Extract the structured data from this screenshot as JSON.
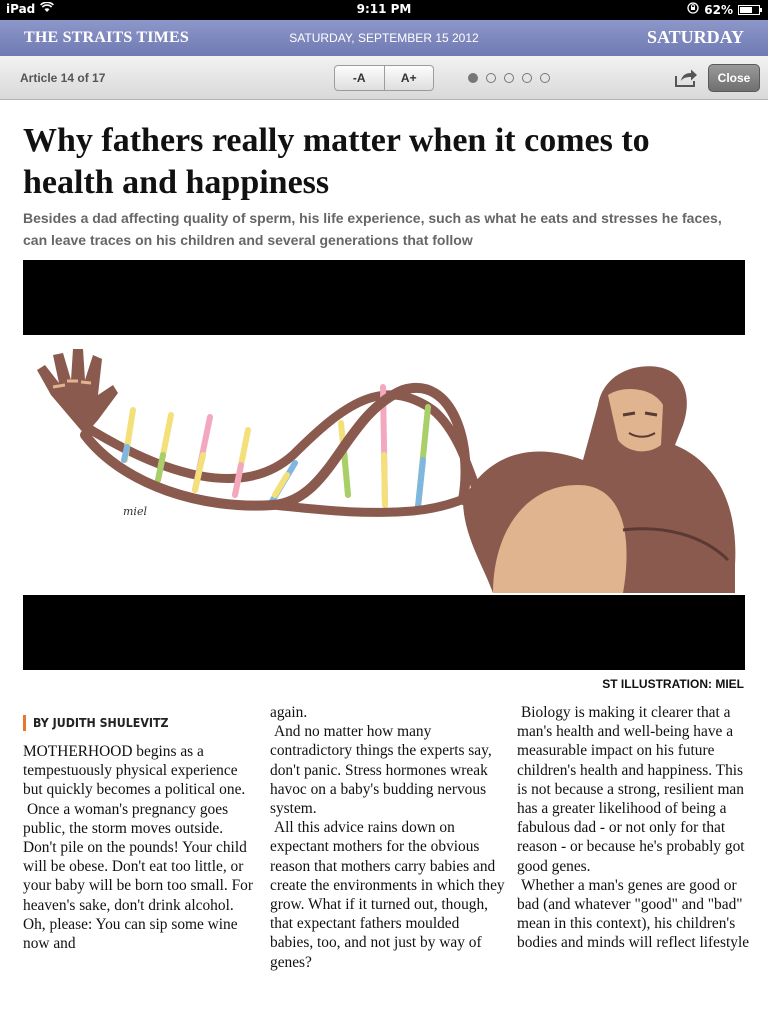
{
  "status_bar": {
    "device": "iPad",
    "time": "9:11 PM",
    "battery": "62%",
    "battery_level": 0.62
  },
  "masthead": {
    "brand": "THE STRAITS TIMES",
    "date": "SATURDAY, SEPTEMBER 15 2012",
    "edition_day": "SATURDAY"
  },
  "toolbar": {
    "article_counter": "Article 14 of 17",
    "font_smaller": "-A",
    "font_larger": "A+",
    "page_dots": 5,
    "active_page": 1,
    "share_icon": "share-icon",
    "close_label": "Close"
  },
  "article": {
    "headline": "Why fathers really matter when it comes to health and happiness",
    "standfirst": "Besides a dad affecting quality of sperm, his life experience, such as what he eats and stresses he faces, can leave traces on his children and several generations that follow",
    "caption": "ST ILLUSTRATION: MIEL",
    "signature": "miel",
    "byline": "BY JUDITH SHULEVITZ",
    "col1": {
      "p1": "MOTHERHOOD begins as a tempestuously physical experience but quickly becomes a political one.",
      "p2": "Once a woman's pregnancy goes public, the storm moves outside. Don't pile on the pounds! Your child will be obese. Don't eat too little, or your baby will be born too small. For heaven's sake, don't drink alcohol. Oh, please: You can sip some wine now and"
    },
    "col2": {
      "p1": "again.",
      "p2": "And no matter how many contradictory things the experts say, don't panic. Stress hormones wreak havoc on a baby's budding nervous system.",
      "p3": "All this advice rains down on expectant mothers for the obvious reason that mothers carry babies and create the environments in which they grow. What if it turned out, though, that expectant fathers moulded babies, too, and not just by way of genes?"
    },
    "col3": {
      "p1": "Biology is making it clearer that a man's health and well-being have a measurable impact on his future children's health and happiness. This is not because a strong, resilient man has a greater likelihood of being a fabulous dad - or not only for that reason - or because he's probably got good genes.",
      "p2": "Whether a man's genes are good or bad (and whatever \"good\" and \"bad\" mean in this context), his children's bodies and minds will reflect lifestyle"
    }
  },
  "colors": {
    "masthead": "#7d88bf",
    "accent": "#e8772e",
    "dna_brown": "#8b5a4f",
    "skin": "#e0b48e"
  }
}
